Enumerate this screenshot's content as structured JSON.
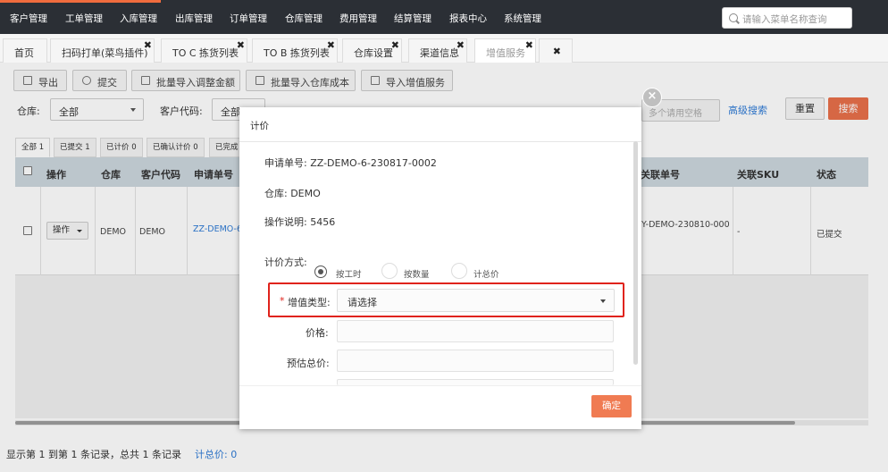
{
  "topnav": {
    "items": [
      "客户管理",
      "工单管理",
      "入库管理",
      "出库管理",
      "订单管理",
      "仓库管理",
      "费用管理",
      "结算管理",
      "报表中心",
      "系统管理"
    ],
    "search_placeholder": "请输入菜单名称查询",
    "accent_color": "#f06c3e"
  },
  "tabs": [
    "首页",
    "扫码打单(菜鸟插件)",
    "TO C 拣货列表",
    "TO B 拣货列表",
    "仓库设置",
    "渠道信息",
    "增值服务"
  ],
  "toolbar": [
    "导出",
    "提交",
    "批量导入调整金额",
    "批量导入仓库成本",
    "导入增值服务"
  ],
  "filters": {
    "warehouse_label": "仓库:",
    "warehouse_value": "全部",
    "customer_label": "客户代码:",
    "customer_value": "全部",
    "multi_placeholder": "多个请用空格",
    "advanced_search": "高级搜索",
    "reset": "重置",
    "search": "搜索"
  },
  "status_tabs": [
    "全部 1",
    "已提交 1",
    "已计价 0",
    "已确认计价 0",
    "已完成"
  ],
  "table": {
    "headers": [
      "操作",
      "仓库",
      "客户代码",
      "申请单号",
      "关联单号",
      "关联SKU",
      "状态"
    ],
    "row": {
      "op": "操作",
      "warehouse": "DEMO",
      "customer": "DEMO",
      "order_no": "ZZ-DEMO-6",
      "related_no": "Y-DEMO-230810-000",
      "related_sku": "-",
      "status": "已提交"
    }
  },
  "footer": {
    "records": "显示第 1 到第 1 条记录，总共 1 条记录",
    "total": "计总价: 0"
  },
  "modal": {
    "title": "计价",
    "close_symbol": "×",
    "order_line": "申请单号:   ZZ-DEMO-6-230817-0002",
    "warehouse_line": "仓库:   DEMO",
    "desc_line": "操作说明:   5456",
    "pricing_method_label": "计价方式:",
    "pricing_options": [
      "按工时",
      "按数量",
      "计总价"
    ],
    "selected_option": "按工时",
    "service_type_label": "增值类型:",
    "service_type_value": "请选择",
    "required_mark": "*",
    "price_label": "价格:",
    "estimated_total_label": "预估总价:",
    "confirm": "确定",
    "highlight_color": "#e0231c"
  }
}
